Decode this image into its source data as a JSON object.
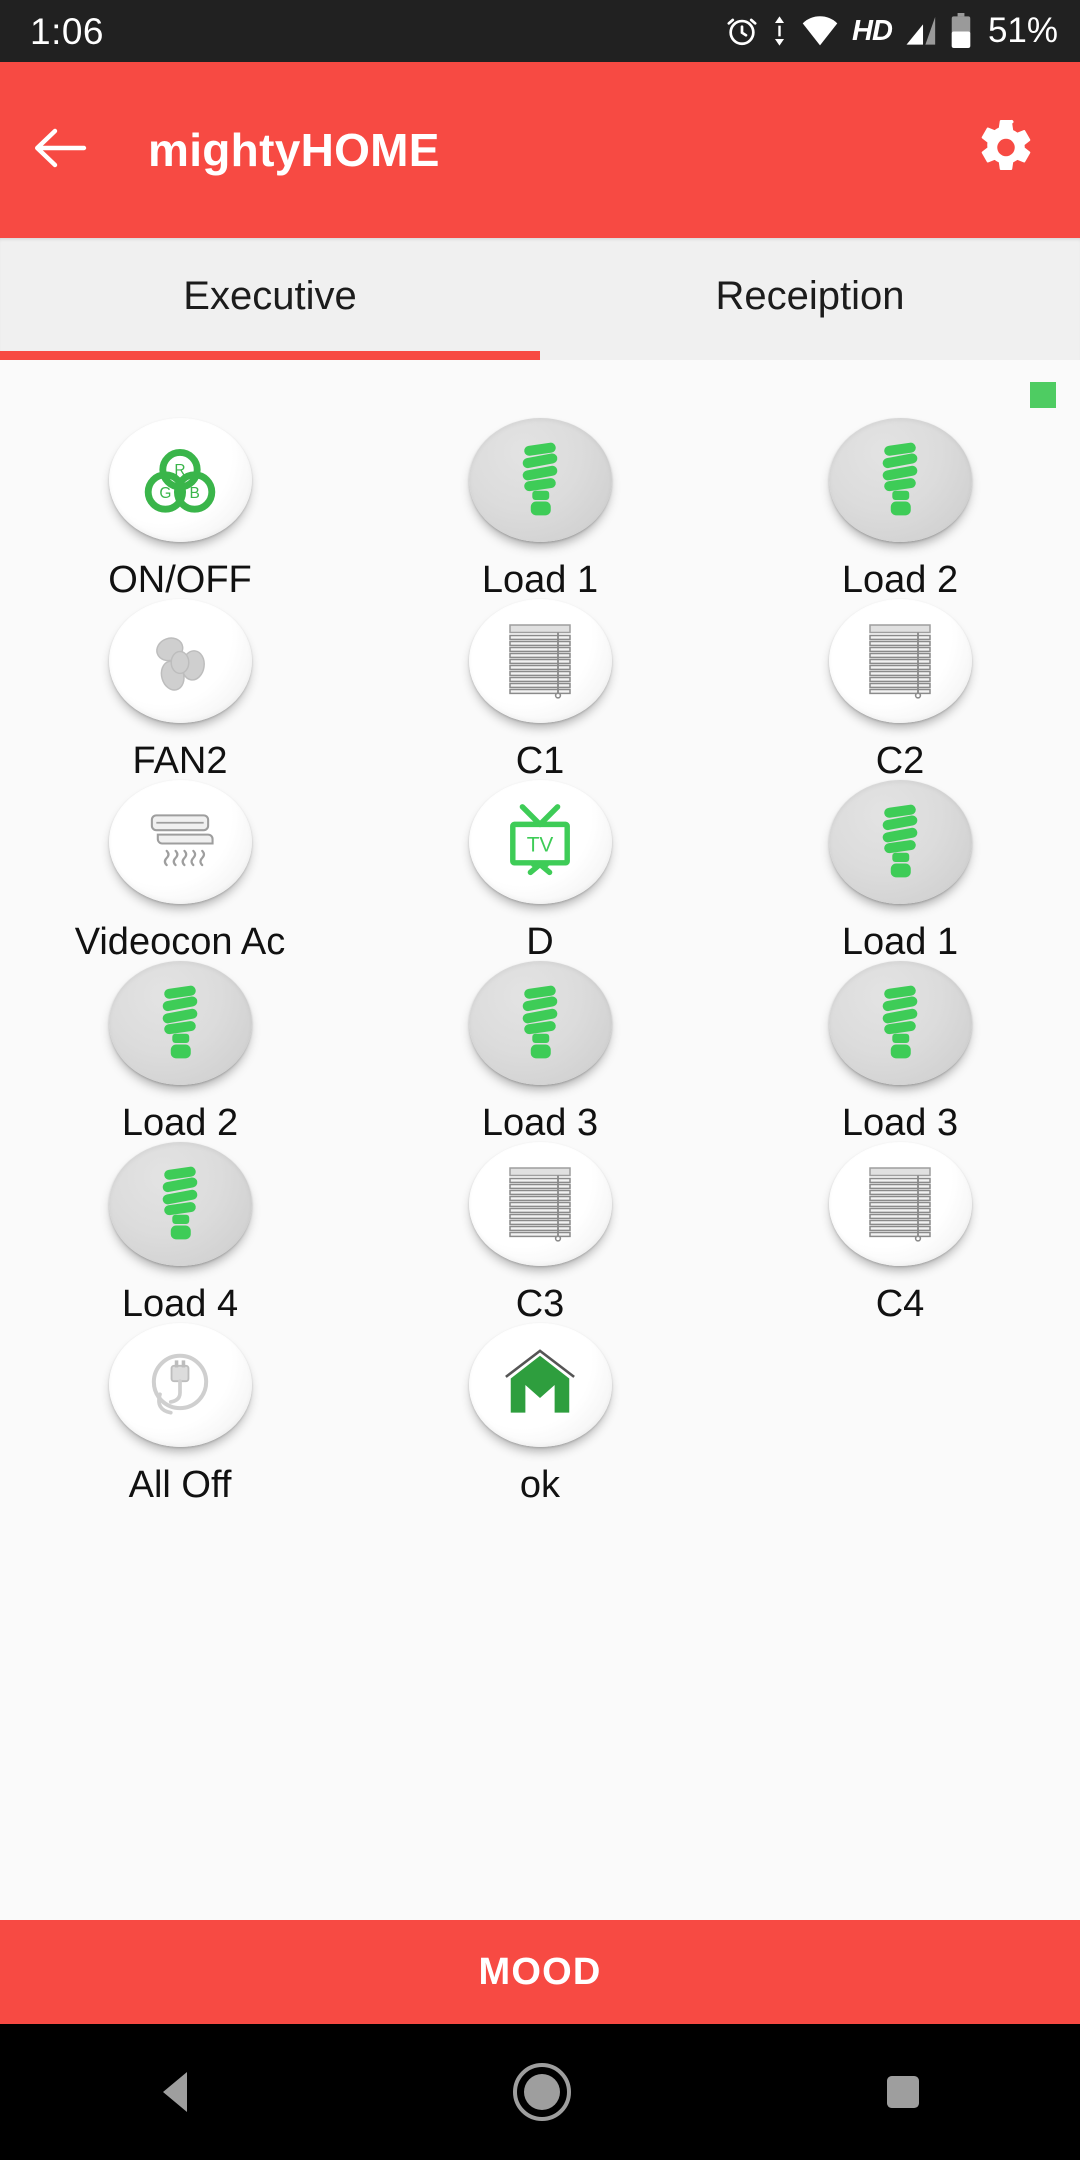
{
  "status_bar": {
    "time": "1:06",
    "battery_percent": "51%",
    "hd_label": "HD",
    "icons": [
      "alarm-icon",
      "data-transfer-icon",
      "wifi-icon",
      "hd-icon",
      "signal-icon",
      "battery-icon"
    ]
  },
  "app_bar": {
    "title": "mightyHOME",
    "back_icon": "arrow-left-icon",
    "settings_icon": "gear-icon",
    "background_color": "#f74a43"
  },
  "tabs": [
    {
      "label": "Executive",
      "active": true
    },
    {
      "label": "Receiption",
      "active": false
    }
  ],
  "content": {
    "status_indicator_color": "#4ecc62",
    "background_color": "#fafafa",
    "devices": [
      {
        "label": "ON/OFF",
        "icon": "rgb-logo-icon",
        "state": "off",
        "accent": "#3ab54a"
      },
      {
        "label": "Load 1",
        "icon": "cfl-bulb-icon",
        "state": "on",
        "accent": "#3ecc57"
      },
      {
        "label": "Load 2",
        "icon": "cfl-bulb-icon",
        "state": "on",
        "accent": "#3ecc57"
      },
      {
        "label": "FAN2",
        "icon": "fan-icon",
        "state": "off",
        "accent": "#c9c9c9"
      },
      {
        "label": "C1",
        "icon": "blinds-icon",
        "state": "off",
        "accent": "#b5b5b5"
      },
      {
        "label": "C2",
        "icon": "blinds-icon",
        "state": "off",
        "accent": "#b5b5b5"
      },
      {
        "label": "Videocon Ac",
        "icon": "air-conditioner-icon",
        "state": "off",
        "accent": "#bdbdbd"
      },
      {
        "label": "D",
        "icon": "tv-icon",
        "state": "off",
        "accent": "#3ecc57"
      },
      {
        "label": "Load 1",
        "icon": "cfl-bulb-icon",
        "state": "on",
        "accent": "#3ecc57"
      },
      {
        "label": "Load 2",
        "icon": "cfl-bulb-icon",
        "state": "on",
        "accent": "#3ecc57"
      },
      {
        "label": "Load 3",
        "icon": "cfl-bulb-icon",
        "state": "on",
        "accent": "#3ecc57"
      },
      {
        "label": "Load 3",
        "icon": "cfl-bulb-icon",
        "state": "on",
        "accent": "#3ecc57"
      },
      {
        "label": "Load 4",
        "icon": "cfl-bulb-icon",
        "state": "on",
        "accent": "#3ecc57"
      },
      {
        "label": "C3",
        "icon": "blinds-icon",
        "state": "off",
        "accent": "#b5b5b5"
      },
      {
        "label": "C4",
        "icon": "blinds-icon",
        "state": "off",
        "accent": "#b5b5b5"
      },
      {
        "label": "All Off",
        "icon": "power-plug-icon",
        "state": "off",
        "accent": "#c4c4c4"
      },
      {
        "label": "ok",
        "icon": "home-m-logo-icon",
        "state": "off",
        "accent": "#2e9e3e"
      }
    ]
  },
  "mood_bar": {
    "label": "MOOD",
    "background_color": "#f74a43"
  },
  "nav_bar": {
    "back_icon": "nav-back-triangle-icon",
    "home_icon": "nav-home-circle-icon",
    "recents_icon": "nav-recents-square-icon"
  }
}
